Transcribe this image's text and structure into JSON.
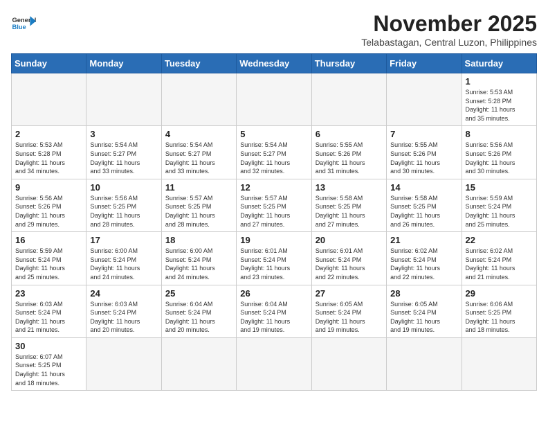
{
  "header": {
    "logo_general": "General",
    "logo_blue": "Blue",
    "month_title": "November 2025",
    "location": "Telabastagan, Central Luzon, Philippines"
  },
  "weekdays": [
    "Sunday",
    "Monday",
    "Tuesday",
    "Wednesday",
    "Thursday",
    "Friday",
    "Saturday"
  ],
  "weeks": [
    [
      {
        "day": "",
        "info": ""
      },
      {
        "day": "",
        "info": ""
      },
      {
        "day": "",
        "info": ""
      },
      {
        "day": "",
        "info": ""
      },
      {
        "day": "",
        "info": ""
      },
      {
        "day": "",
        "info": ""
      },
      {
        "day": "1",
        "info": "Sunrise: 5:53 AM\nSunset: 5:28 PM\nDaylight: 11 hours\nand 35 minutes."
      }
    ],
    [
      {
        "day": "2",
        "info": "Sunrise: 5:53 AM\nSunset: 5:28 PM\nDaylight: 11 hours\nand 34 minutes."
      },
      {
        "day": "3",
        "info": "Sunrise: 5:54 AM\nSunset: 5:27 PM\nDaylight: 11 hours\nand 33 minutes."
      },
      {
        "day": "4",
        "info": "Sunrise: 5:54 AM\nSunset: 5:27 PM\nDaylight: 11 hours\nand 33 minutes."
      },
      {
        "day": "5",
        "info": "Sunrise: 5:54 AM\nSunset: 5:27 PM\nDaylight: 11 hours\nand 32 minutes."
      },
      {
        "day": "6",
        "info": "Sunrise: 5:55 AM\nSunset: 5:26 PM\nDaylight: 11 hours\nand 31 minutes."
      },
      {
        "day": "7",
        "info": "Sunrise: 5:55 AM\nSunset: 5:26 PM\nDaylight: 11 hours\nand 30 minutes."
      },
      {
        "day": "8",
        "info": "Sunrise: 5:56 AM\nSunset: 5:26 PM\nDaylight: 11 hours\nand 30 minutes."
      }
    ],
    [
      {
        "day": "9",
        "info": "Sunrise: 5:56 AM\nSunset: 5:26 PM\nDaylight: 11 hours\nand 29 minutes."
      },
      {
        "day": "10",
        "info": "Sunrise: 5:56 AM\nSunset: 5:25 PM\nDaylight: 11 hours\nand 28 minutes."
      },
      {
        "day": "11",
        "info": "Sunrise: 5:57 AM\nSunset: 5:25 PM\nDaylight: 11 hours\nand 28 minutes."
      },
      {
        "day": "12",
        "info": "Sunrise: 5:57 AM\nSunset: 5:25 PM\nDaylight: 11 hours\nand 27 minutes."
      },
      {
        "day": "13",
        "info": "Sunrise: 5:58 AM\nSunset: 5:25 PM\nDaylight: 11 hours\nand 27 minutes."
      },
      {
        "day": "14",
        "info": "Sunrise: 5:58 AM\nSunset: 5:25 PM\nDaylight: 11 hours\nand 26 minutes."
      },
      {
        "day": "15",
        "info": "Sunrise: 5:59 AM\nSunset: 5:24 PM\nDaylight: 11 hours\nand 25 minutes."
      }
    ],
    [
      {
        "day": "16",
        "info": "Sunrise: 5:59 AM\nSunset: 5:24 PM\nDaylight: 11 hours\nand 25 minutes."
      },
      {
        "day": "17",
        "info": "Sunrise: 6:00 AM\nSunset: 5:24 PM\nDaylight: 11 hours\nand 24 minutes."
      },
      {
        "day": "18",
        "info": "Sunrise: 6:00 AM\nSunset: 5:24 PM\nDaylight: 11 hours\nand 24 minutes."
      },
      {
        "day": "19",
        "info": "Sunrise: 6:01 AM\nSunset: 5:24 PM\nDaylight: 11 hours\nand 23 minutes."
      },
      {
        "day": "20",
        "info": "Sunrise: 6:01 AM\nSunset: 5:24 PM\nDaylight: 11 hours\nand 22 minutes."
      },
      {
        "day": "21",
        "info": "Sunrise: 6:02 AM\nSunset: 5:24 PM\nDaylight: 11 hours\nand 22 minutes."
      },
      {
        "day": "22",
        "info": "Sunrise: 6:02 AM\nSunset: 5:24 PM\nDaylight: 11 hours\nand 21 minutes."
      }
    ],
    [
      {
        "day": "23",
        "info": "Sunrise: 6:03 AM\nSunset: 5:24 PM\nDaylight: 11 hours\nand 21 minutes."
      },
      {
        "day": "24",
        "info": "Sunrise: 6:03 AM\nSunset: 5:24 PM\nDaylight: 11 hours\nand 20 minutes."
      },
      {
        "day": "25",
        "info": "Sunrise: 6:04 AM\nSunset: 5:24 PM\nDaylight: 11 hours\nand 20 minutes."
      },
      {
        "day": "26",
        "info": "Sunrise: 6:04 AM\nSunset: 5:24 PM\nDaylight: 11 hours\nand 19 minutes."
      },
      {
        "day": "27",
        "info": "Sunrise: 6:05 AM\nSunset: 5:24 PM\nDaylight: 11 hours\nand 19 minutes."
      },
      {
        "day": "28",
        "info": "Sunrise: 6:05 AM\nSunset: 5:24 PM\nDaylight: 11 hours\nand 19 minutes."
      },
      {
        "day": "29",
        "info": "Sunrise: 6:06 AM\nSunset: 5:25 PM\nDaylight: 11 hours\nand 18 minutes."
      }
    ],
    [
      {
        "day": "30",
        "info": "Sunrise: 6:07 AM\nSunset: 5:25 PM\nDaylight: 11 hours\nand 18 minutes."
      },
      {
        "day": "",
        "info": ""
      },
      {
        "day": "",
        "info": ""
      },
      {
        "day": "",
        "info": ""
      },
      {
        "day": "",
        "info": ""
      },
      {
        "day": "",
        "info": ""
      },
      {
        "day": "",
        "info": ""
      }
    ]
  ]
}
